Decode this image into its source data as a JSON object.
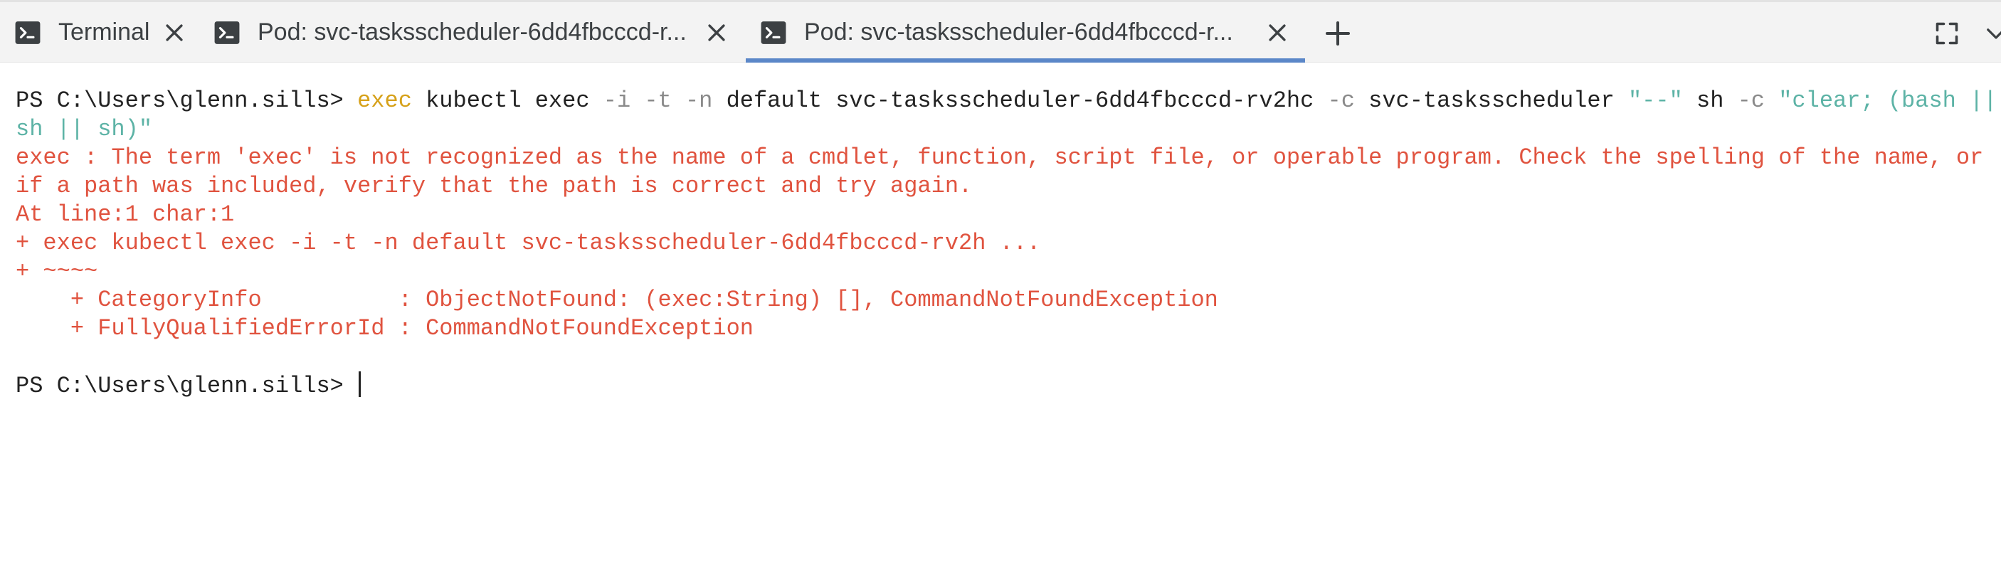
{
  "tabs": [
    {
      "label": "Terminal",
      "icon": "terminal-icon",
      "active": false
    },
    {
      "label": "Pod: svc-tasksscheduler-6dd4fbcccd-r...",
      "icon": "terminal-icon",
      "active": false
    },
    {
      "label": "Pod: svc-tasksscheduler-6dd4fbcccd-r...",
      "icon": "terminal-icon",
      "active": true
    }
  ],
  "colors": {
    "accent": "#5b87c8",
    "error": "#e0533f",
    "command": "#d6a11a",
    "string": "#5db3a6",
    "parameter": "#8a8a8a"
  },
  "terminal": {
    "cmd": {
      "prompt": "PS C:\\Users\\glenn.sills> ",
      "exec": "exec",
      "t1": " kubectl exec ",
      "p1": "-i",
      "s1": " ",
      "p2": "-t",
      "s2": " ",
      "p3": "-n",
      "t2": " default svc-tasksscheduler-6dd4fbcccd-rv2hc ",
      "p4": "-c",
      "t3": " svc-tasksscheduler ",
      "q1": "\"--\"",
      "t4": " sh ",
      "p5": "-c",
      "s3": " ",
      "q2": "\"clear; (bash || a",
      "q2b": "sh || sh)\""
    },
    "error_lines": [
      "exec : The term 'exec' is not recognized as the name of a cmdlet, function, script file, or operable program. Check the spelling of the name, or",
      "if a path was included, verify that the path is correct and try again.",
      "At line:1 char:1",
      "+ exec kubectl exec -i -t -n default svc-tasksscheduler-6dd4fbcccd-rv2h ...",
      "+ ~~~~",
      "    + CategoryInfo          : ObjectNotFound: (exec:String) [], CommandNotFoundException",
      "    + FullyQualifiedErrorId : CommandNotFoundException"
    ],
    "final_prompt": "PS C:\\Users\\glenn.sills> "
  }
}
